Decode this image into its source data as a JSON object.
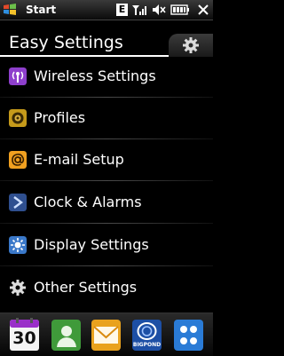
{
  "status_bar": {
    "start_label": "Start",
    "network_badge": "E",
    "icons": [
      "windows-flag-icon",
      "signal-icon",
      "speaker-muted-icon",
      "battery-icon",
      "close-icon"
    ]
  },
  "header": {
    "title": "Easy Settings",
    "tab_icon": "gear-icon"
  },
  "menu": {
    "items": [
      {
        "label": "Wireless Settings",
        "icon": "wireless-icon",
        "color": "#8e3fcc"
      },
      {
        "label": "Profiles",
        "icon": "speaker-icon",
        "color": "#c59a1a"
      },
      {
        "label": "E-mail Setup",
        "icon": "at-sign-icon",
        "color": "#f0a020"
      },
      {
        "label": "Clock & Alarms",
        "icon": "clock-icon",
        "color": "#2f4f8f"
      },
      {
        "label": "Display Settings",
        "icon": "display-icon",
        "color": "#3a78c9"
      },
      {
        "label": "Other Settings",
        "icon": "gear-icon",
        "color": "#dddddd"
      }
    ]
  },
  "dock": {
    "calendar_day": "30",
    "bigpond_label": "BIGPOND",
    "icons": [
      "calendar-icon",
      "contacts-icon",
      "messaging-icon",
      "bigpond-icon",
      "apps-grid-icon"
    ]
  },
  "colors": {
    "background": "#000000",
    "text": "#ffffff",
    "accent": "#2a7bd6"
  }
}
